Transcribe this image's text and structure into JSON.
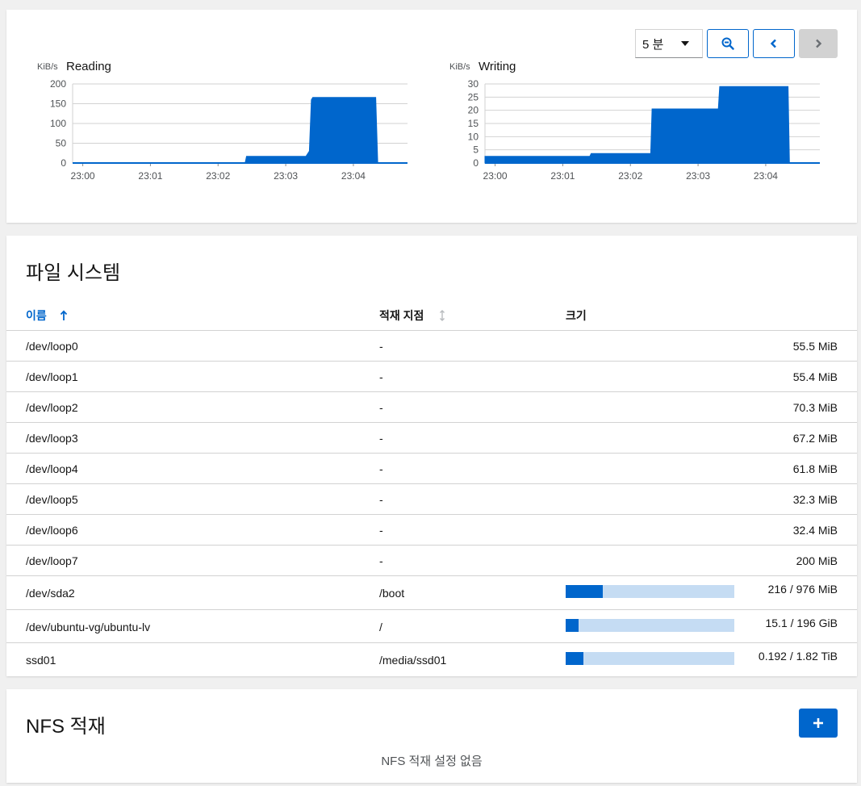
{
  "toolbar": {
    "range_value": "5 분",
    "icons": {
      "zoom": "zoom-out-icon",
      "prev": "chevron-left-icon",
      "next": "chevron-right-icon"
    }
  },
  "graphs": [
    {
      "unit": "KiB/s",
      "title": "Reading",
      "chart_data": {
        "type": "area",
        "ylim": [
          0,
          200
        ],
        "y_ticks": [
          0,
          50,
          100,
          150,
          200
        ],
        "x_ticks": [
          "23:00",
          "23:01",
          "23:02",
          "23:03",
          "23:04"
        ],
        "xlim": [
          -0.15,
          4.8
        ],
        "color": "#0066cc",
        "points": [
          [
            -0.15,
            0
          ],
          [
            2.4,
            0
          ],
          [
            2.42,
            17
          ],
          [
            3.3,
            17
          ],
          [
            3.35,
            30
          ],
          [
            3.38,
            160
          ],
          [
            3.4,
            166
          ],
          [
            4.33,
            166
          ],
          [
            4.36,
            0
          ],
          [
            4.8,
            0
          ]
        ],
        "grid": true
      }
    },
    {
      "unit": "KiB/s",
      "title": "Writing",
      "chart_data": {
        "type": "area",
        "ylim": [
          0,
          30
        ],
        "y_ticks": [
          0,
          5,
          10,
          15,
          20,
          25,
          30
        ],
        "x_ticks": [
          "23:00",
          "23:01",
          "23:02",
          "23:03",
          "23:04"
        ],
        "xlim": [
          -0.15,
          4.8
        ],
        "color": "#0066cc",
        "points": [
          [
            -0.15,
            2.5
          ],
          [
            1.4,
            2.5
          ],
          [
            1.42,
            3.6
          ],
          [
            2.3,
            3.6
          ],
          [
            2.32,
            20.5
          ],
          [
            3.3,
            20.5
          ],
          [
            3.32,
            29
          ],
          [
            4.33,
            29
          ],
          [
            4.35,
            0
          ],
          [
            4.8,
            0
          ]
        ],
        "grid": true
      }
    }
  ],
  "filesystems": {
    "title": "파일 시스템",
    "columns": {
      "name": "이름",
      "mount": "적재 지점",
      "size": "크기"
    },
    "rows": [
      {
        "name": "/dev/loop0",
        "mount": "-",
        "size": "55.5 MiB"
      },
      {
        "name": "/dev/loop1",
        "mount": "-",
        "size": "55.4 MiB"
      },
      {
        "name": "/dev/loop2",
        "mount": "-",
        "size": "70.3 MiB"
      },
      {
        "name": "/dev/loop3",
        "mount": "-",
        "size": "67.2 MiB"
      },
      {
        "name": "/dev/loop4",
        "mount": "-",
        "size": "61.8 MiB"
      },
      {
        "name": "/dev/loop5",
        "mount": "-",
        "size": "32.3 MiB"
      },
      {
        "name": "/dev/loop6",
        "mount": "-",
        "size": "32.4 MiB"
      },
      {
        "name": "/dev/loop7",
        "mount": "-",
        "size": "200 MiB"
      },
      {
        "name": "/dev/sda2",
        "mount": "/boot",
        "size": "216 / 976 MiB",
        "usage": 0.221
      },
      {
        "name": "/dev/ubuntu-vg/ubuntu-lv",
        "mount": "/",
        "size": "15.1 / 196 GiB",
        "usage": 0.077
      },
      {
        "name": "ssd01",
        "mount": "/media/ssd01",
        "size": "0.192 / 1.82 TiB",
        "usage": 0.105
      }
    ]
  },
  "nfs": {
    "title": "NFS 적재",
    "empty_message": "NFS 적재 설정 없음",
    "add_icon": "plus-icon"
  }
}
